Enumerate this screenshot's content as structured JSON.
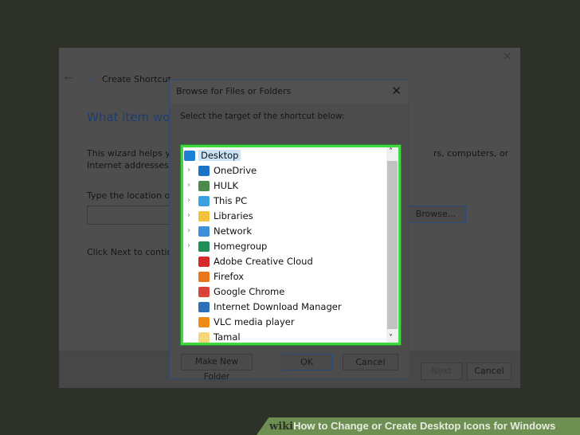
{
  "wizard": {
    "title": "Create Shortcut",
    "heading": "What item woul",
    "desc_line1_left": "This wizard helps yo",
    "desc_line1_right": "rs, computers, or",
    "desc_line2": "Internet addresses.",
    "location_label": "Type the location of",
    "browse_label": "Browse...",
    "continue_text": "Click Next to continu",
    "next_label": "Next",
    "cancel_label": "Cancel"
  },
  "dialog": {
    "title": "Browse for Files or Folders",
    "instruction": "Select the target of the shortcut below:",
    "items": [
      {
        "label": "Desktop",
        "icon": "desktop-icon",
        "color": "#1e7fd6"
      },
      {
        "label": "OneDrive",
        "icon": "onedrive-icon",
        "color": "#1a73c9"
      },
      {
        "label": "HULK",
        "icon": "user-icon",
        "color": "#4b8a4b"
      },
      {
        "label": "This PC",
        "icon": "computer-icon",
        "color": "#3aa0e0"
      },
      {
        "label": "Libraries",
        "icon": "libraries-icon",
        "color": "#f2c23c"
      },
      {
        "label": "Network",
        "icon": "network-icon",
        "color": "#3c8fd8"
      },
      {
        "label": "Homegroup",
        "icon": "homegroup-icon",
        "color": "#1f8f5a"
      },
      {
        "label": "Adobe Creative Cloud",
        "icon": "adobe-cc-icon",
        "color": "#d42a2a"
      },
      {
        "label": "Firefox",
        "icon": "firefox-icon",
        "color": "#e8751a"
      },
      {
        "label": "Google Chrome",
        "icon": "chrome-icon",
        "color": "#d9433a"
      },
      {
        "label": "Internet Download Manager",
        "icon": "idm-icon",
        "color": "#2c6fb8"
      },
      {
        "label": "VLC media player",
        "icon": "vlc-icon",
        "color": "#f08a12"
      },
      {
        "label": "Tamal",
        "icon": "folder-icon",
        "color": "#f5d67a"
      }
    ],
    "make_folder_label": "Make New Folder",
    "ok_label": "OK",
    "cancel_label": "Cancel"
  },
  "banner": {
    "brand_wiki": "wiki",
    "brand_how": "How",
    "title": " to Change or Create Desktop Icons for Windows"
  }
}
